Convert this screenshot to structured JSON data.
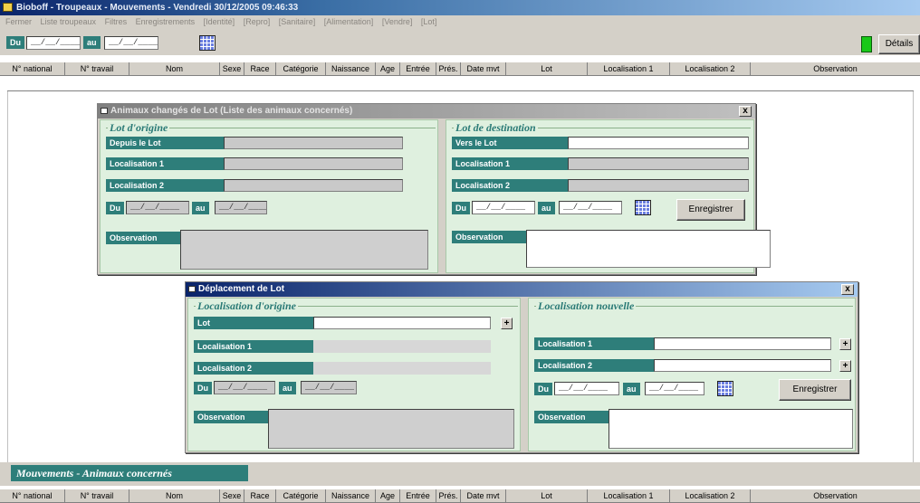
{
  "window": {
    "title": "Bioboff - Troupeaux - Mouvements - Vendredi  30/12/2005 09:46:33"
  },
  "menu": [
    "Fermer",
    "Liste troupeaux",
    "Filtres",
    "Enregistrements",
    "[Identité]",
    "[Repro]",
    "[Sanitaire]",
    "[Alimentation]",
    "[Vendre]",
    "[Lot]"
  ],
  "toolbar": {
    "du_label": "Du",
    "au_label": "au",
    "date_from": "__/__/____",
    "date_to": "__/__/____",
    "details_label": "Détails"
  },
  "grid_columns": [
    "N° national",
    "N° travail",
    "Nom",
    "Sexe",
    "Race",
    "Catégorie",
    "Naissance",
    "Age",
    "Entrée",
    "Prés.",
    "Date mvt",
    "Lot",
    "Localisation 1",
    "Localisation 2",
    "Observation"
  ],
  "dialog1": {
    "title": "Animaux changés de Lot (Liste des animaux concernés)",
    "close": "x",
    "left_group": "Lot d'origine",
    "right_group": "Lot de destination",
    "depuis_lot": "Depuis le Lot",
    "vers_lot": "Vers le Lot",
    "localisation1": "Localisation  1",
    "localisation2": "Localisation  2",
    "du": "Du",
    "au": "au",
    "date": "__/__/____",
    "observation": "Observation",
    "save": "Enregistrer"
  },
  "dialog2": {
    "title": "Déplacement de Lot",
    "close": "x",
    "left_group": "Localisation d'origine",
    "right_group": "Localisation nouvelle",
    "lot": "Lot",
    "localisation1": "Localisation  1",
    "localisation2": "Localisation  2",
    "du": "Du",
    "au": "au",
    "date": "__/__/____",
    "observation": "Observation",
    "save": "Enregistrer",
    "plus": "+"
  },
  "bottom_section": {
    "title": "Mouvements - Animaux concernés"
  }
}
